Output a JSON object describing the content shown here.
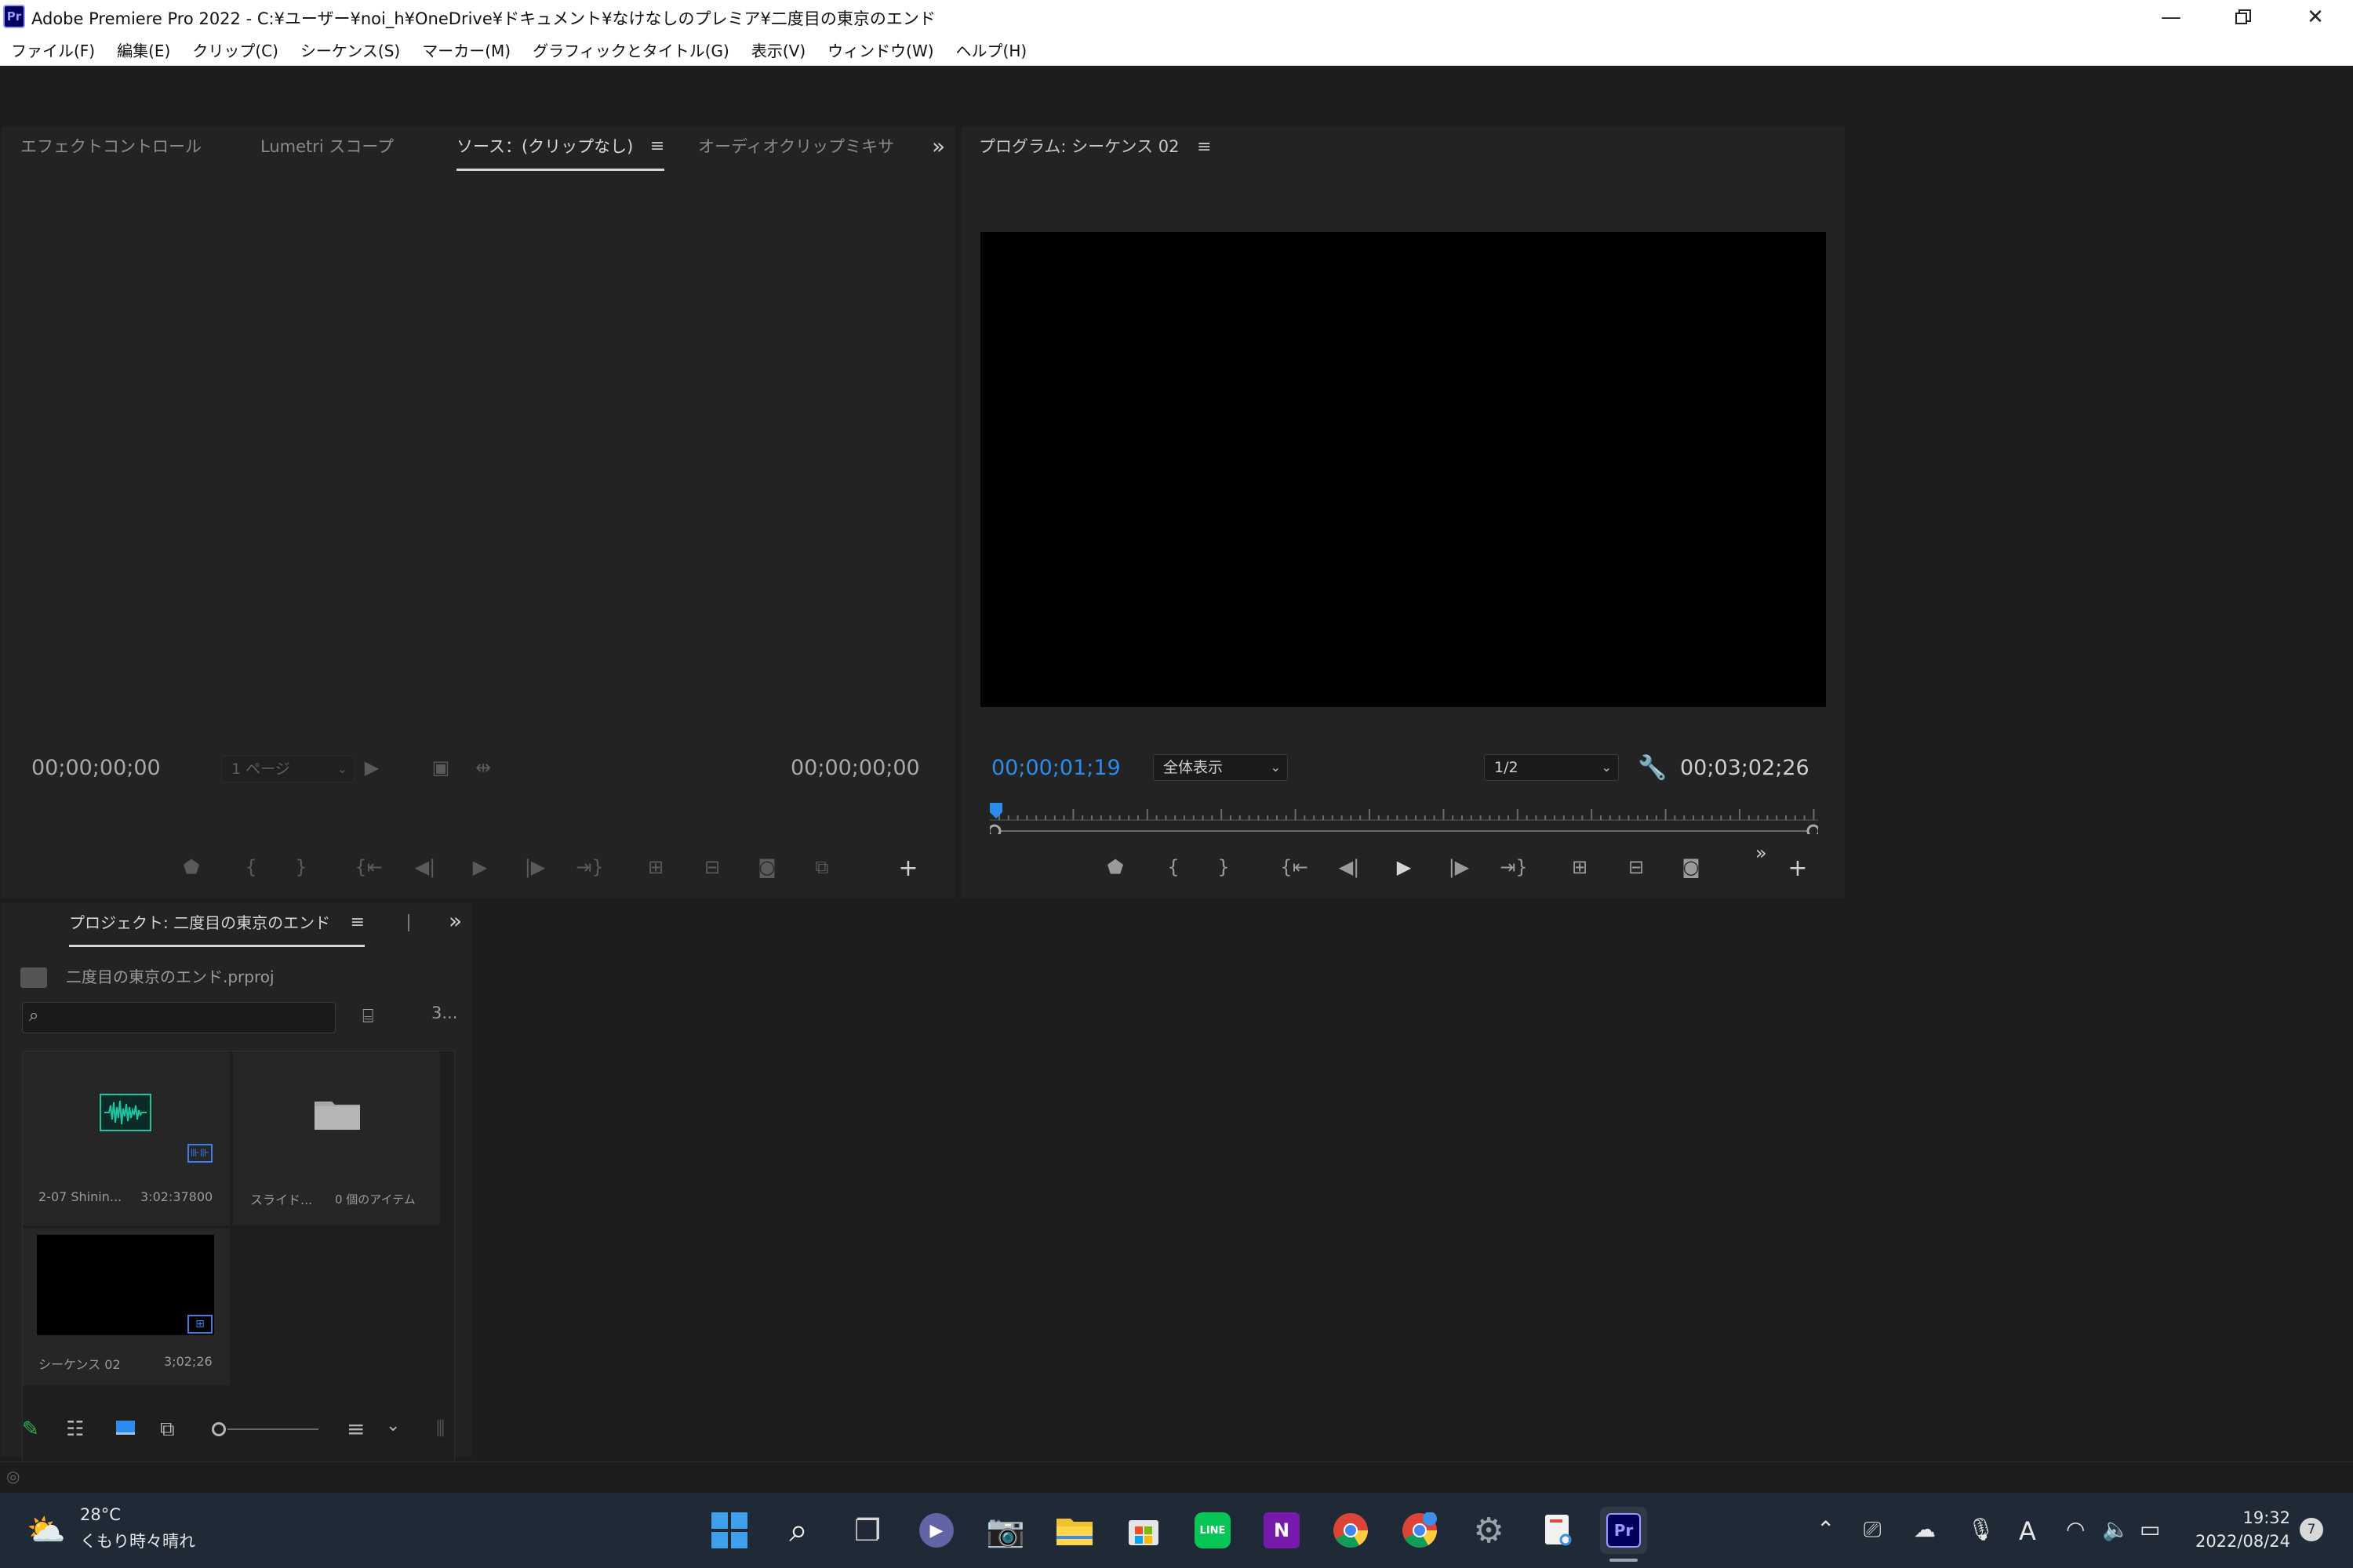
{
  "titlebar": {
    "app_icon": "Pr",
    "title": "Adobe Premiere Pro 2022 - C:¥ユーザー¥noi_h¥OneDrive¥ドキュメント¥なけなしのプレミア¥二度目の東京のエンド",
    "controls": [
      "minimize",
      "restore",
      "close"
    ]
  },
  "menu": [
    "ファイル(F)",
    "編集(E)",
    "クリップ(C)",
    "シーケンス(S)",
    "マーカー(M)",
    "グラフィックとタイトル(G)",
    "表示(V)",
    "ウィンドウ(W)",
    "ヘルプ(H)"
  ],
  "source_panel": {
    "tabs": [
      "エフェクトコントロール",
      "Lumetri スコープ",
      "ソース：(クリップなし)",
      "オーディオクリップミキサ-"
    ],
    "active_tab": 2,
    "timecode_left": "00;00;00;00",
    "page_select": "1 ページ",
    "timecode_right": "00;00;00;00"
  },
  "program_panel": {
    "tab": "プログラム: シーケンス 02",
    "timecode_current": "00;00;01;19",
    "zoom_select": "全体表示",
    "resolution_select": "1/2",
    "timecode_duration": "00;03;02;26"
  },
  "project_panel": {
    "tab": "プロジェクト: 二度目の東京のエンド",
    "project_file": "二度目の東京のエンド.prproj",
    "search_placeholder": "",
    "item_count": "3...",
    "items": [
      {
        "name": "2-07 Shinin...",
        "meta": "3:02:37800",
        "kind": "audio"
      },
      {
        "name": "スライド...",
        "meta": "0 個のアイテム",
        "kind": "bin"
      },
      {
        "name": "シーケンス 02",
        "meta": "3;02;26",
        "kind": "sequence"
      }
    ]
  },
  "taskbar": {
    "weather_temp": "28°C",
    "weather_desc": "くもり時々晴れ",
    "time": "19:32",
    "date": "2022/08/24",
    "notification_count": "7",
    "ime": "A"
  },
  "colors": {
    "accent_blue": "#2d8ceb",
    "premiere_bg": "#00005b",
    "premiere_fg": "#9999ff",
    "audio_green": "#1fc3a0"
  }
}
